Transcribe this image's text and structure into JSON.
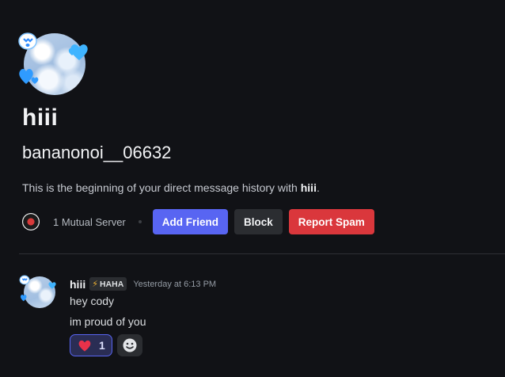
{
  "profile": {
    "display_name": "hiii",
    "username": "bananonoi__06632",
    "intro_prefix": "This is the beginning of your direct message history with ",
    "intro_name": "hiii",
    "intro_suffix": "."
  },
  "actions": {
    "mutual_servers": "1 Mutual Server",
    "add_friend": "Add Friend",
    "block": "Block",
    "report_spam": "Report Spam"
  },
  "message": {
    "author": "hiii",
    "tag_icon": "⚡",
    "tag": "HAHA",
    "timestamp": "Yesterday at 6:13 PM",
    "lines": [
      "hey cody",
      "im proud of you"
    ],
    "reaction": {
      "emoji": "heart",
      "count": "1"
    }
  },
  "colors": {
    "background": "#111216",
    "blurple": "#5865f2",
    "danger": "#da373c",
    "secondary": "#2b2d31"
  },
  "icons": [
    "heart-icon",
    "add-reaction-icon",
    "server-icon",
    "bolt-icon"
  ]
}
